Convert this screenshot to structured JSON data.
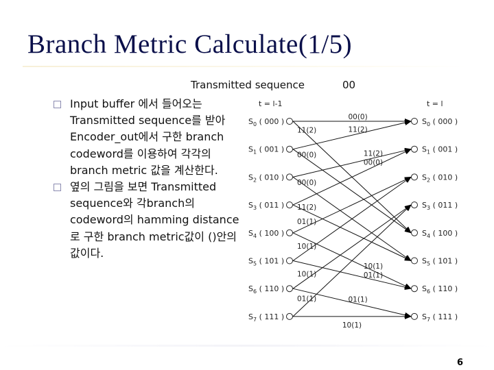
{
  "slide": {
    "title": "Branch Metric Calculate(1/5)",
    "page_number": "6"
  },
  "transmitted": {
    "label": "Transmitted sequence",
    "value": "00"
  },
  "bullets": [
    {
      "icon": "square-bullet-icon",
      "text": "Input buffer 에서 들어오는 Transmitted sequence를 받아 Encoder_out에서 구한 branch codeword를 이용하여 각각의 branch metric 값을 계산한다."
    },
    {
      "icon": "square-bullet-icon",
      "text": "옆의 그림을 보면 Transmitted sequence와 각branch의 codeword의 hamming distance로 구한 branch metric값이 ()안의 값이다."
    }
  ],
  "trellis": {
    "left_time_label": "t = l-1",
    "right_time_label": "t = l",
    "states": [
      {
        "name": "S",
        "sub": "0",
        "bits": "( 000 )"
      },
      {
        "name": "S",
        "sub": "1",
        "bits": "( 001 )"
      },
      {
        "name": "S",
        "sub": "2",
        "bits": "( 010 )"
      },
      {
        "name": "S",
        "sub": "3",
        "bits": "( 011 )"
      },
      {
        "name": "S",
        "sub": "4",
        "bits": "( 100 )"
      },
      {
        "name": "S",
        "sub": "5",
        "bits": "( 101 )"
      },
      {
        "name": "S",
        "sub": "6",
        "bits": "( 110 )"
      },
      {
        "name": "S",
        "sub": "7",
        "bits": "( 111 )"
      }
    ],
    "branches": [
      {
        "from": 0,
        "to": 0,
        "label": "00(0)",
        "label_at": "mid-right"
      },
      {
        "from": 0,
        "to": 4,
        "label": "11(2)",
        "label_at": "left"
      },
      {
        "from": 1,
        "to": 0,
        "label": "11(2)",
        "label_at": "mid-right"
      },
      {
        "from": 1,
        "to": 4,
        "label": "00(0)",
        "label_at": "left"
      },
      {
        "from": 2,
        "to": 1,
        "label": "11(2)",
        "label_at": "right"
      },
      {
        "from": 2,
        "to": 5,
        "label": "00(0)",
        "label_at": "left"
      },
      {
        "from": 3,
        "to": 1,
        "label": "00(0)",
        "label_at": "right"
      },
      {
        "from": 3,
        "to": 5,
        "label": "11(2)",
        "label_at": "left"
      },
      {
        "from": 4,
        "to": 2,
        "label": "01(1)",
        "label_at": "left"
      },
      {
        "from": 4,
        "to": 6,
        "label": "10(1)",
        "label_at": "right"
      },
      {
        "from": 5,
        "to": 2,
        "label": "10(1)",
        "label_at": "left"
      },
      {
        "from": 5,
        "to": 6,
        "label": "01(1)",
        "label_at": "right"
      },
      {
        "from": 6,
        "to": 3,
        "label": "10(1)",
        "label_at": "left"
      },
      {
        "from": 6,
        "to": 7,
        "label": "01(1)",
        "label_at": "mid-right"
      },
      {
        "from": 7,
        "to": 3,
        "label": "01(1)",
        "label_at": "left"
      },
      {
        "from": 7,
        "to": 7,
        "label": "10(1)",
        "label_at": "below"
      }
    ]
  }
}
